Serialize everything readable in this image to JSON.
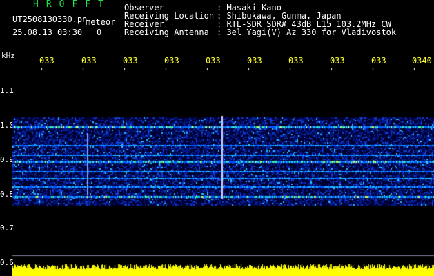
{
  "header": {
    "logo": "HROFFT",
    "filename": "UT2508130330.pn",
    "tag": "meteor",
    "timestamp": "25.08.13 03:30",
    "count": "0_",
    "rows": [
      {
        "label": "Observer",
        "value": ": Masaki Kano"
      },
      {
        "label": "Receiving Location",
        "value": ": Shibukawa, Gunma, Japan"
      },
      {
        "label": "Receiver",
        "value": ": RTL-SDR SDR# 43dB L15 103.2MHz CW"
      },
      {
        "label": "Receiving Antenna",
        "value": ": 3el Yagi(V) Az 330 for Vladivostok"
      }
    ]
  },
  "axis": {
    "unit": "kHz",
    "time_ticks": [
      "033",
      "033",
      "033",
      "033",
      "033",
      "033",
      "033",
      "033",
      "033",
      "0340"
    ],
    "freq_ticks": [
      "1.1",
      "1.0",
      "0.9",
      "0.8",
      "0.7",
      "0.6"
    ]
  },
  "colors": {
    "logo": "#22dd44",
    "ticks": "#ffff33",
    "noise": "#ffff00",
    "signal_bg": "#000080"
  }
}
